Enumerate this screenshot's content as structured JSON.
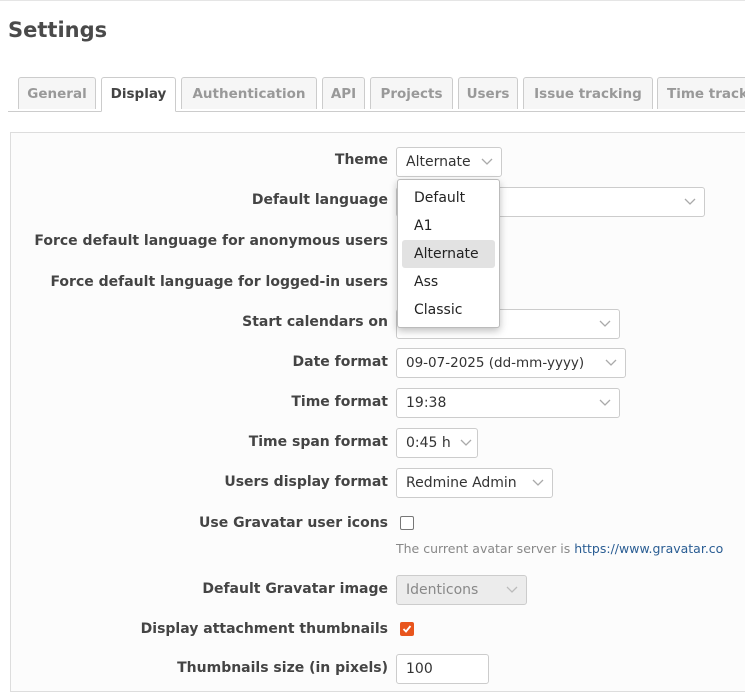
{
  "page": {
    "title": "Settings"
  },
  "tabs": [
    {
      "label": "General",
      "selected": false
    },
    {
      "label": "Display",
      "selected": true
    },
    {
      "label": "Authentication",
      "selected": false
    },
    {
      "label": "API",
      "selected": false
    },
    {
      "label": "Projects",
      "selected": false
    },
    {
      "label": "Users",
      "selected": false
    },
    {
      "label": "Issue tracking",
      "selected": false
    },
    {
      "label": "Time track",
      "selected": false
    }
  ],
  "form": {
    "theme": {
      "label": "Theme",
      "value": "Alternate"
    },
    "default_language": {
      "label": "Default language",
      "value": ""
    },
    "force_lang_anon": {
      "label": "Force default language for anonymous users"
    },
    "force_lang_logged": {
      "label": "Force default language for logged-in users"
    },
    "start_calendars": {
      "label": "Start calendars on",
      "value": ""
    },
    "date_format": {
      "label": "Date format",
      "value": "09-07-2025 (dd-mm-yyyy)"
    },
    "time_format": {
      "label": "Time format",
      "value": "19:38"
    },
    "time_span_format": {
      "label": "Time span format",
      "value": "0:45 h"
    },
    "users_display_format": {
      "label": "Users display format",
      "value": "Redmine Admin"
    },
    "gravatar": {
      "label": "Use Gravatar user icons",
      "checked": false
    },
    "gravatar_hint": {
      "text": "The current avatar server is ",
      "link": "https://www.gravatar.co"
    },
    "default_gravatar": {
      "label": "Default Gravatar image",
      "value": "Identicons",
      "disabled": true
    },
    "attachment_thumbnails": {
      "label": "Display attachment thumbnails",
      "checked": true
    },
    "thumbnail_size": {
      "label": "Thumbnails size (in pixels)",
      "value": "100"
    }
  },
  "theme_dropdown": {
    "options": [
      "Default",
      "A1",
      "Alternate",
      "Ass",
      "Classic"
    ],
    "highlighted": "Alternate"
  },
  "colors": {
    "accent": "#e8551d",
    "link": "#2a5d93"
  }
}
